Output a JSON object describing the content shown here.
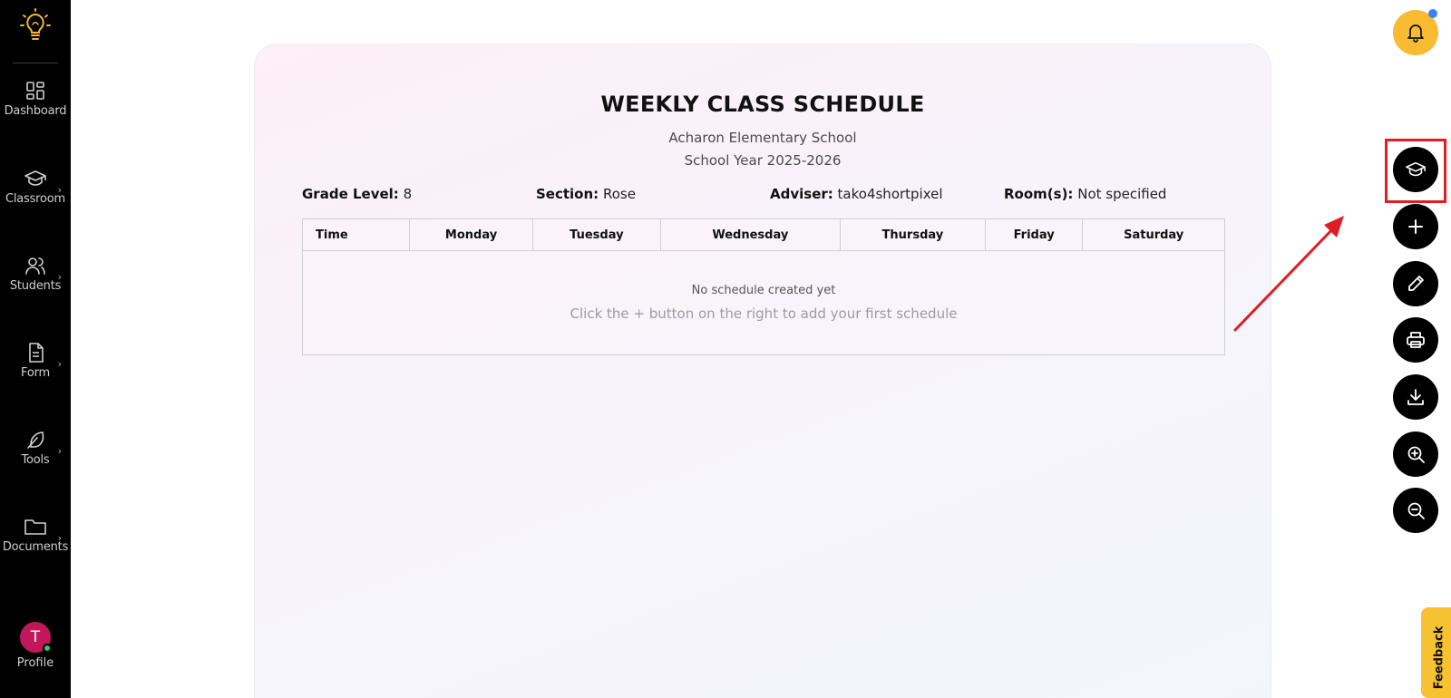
{
  "sidebar": {
    "items": [
      {
        "label": "Dashboard",
        "icon": "dashboard-icon"
      },
      {
        "label": "Classroom",
        "icon": "graduation-cap-icon"
      },
      {
        "label": "Students",
        "icon": "users-icon"
      },
      {
        "label": "Form",
        "icon": "document-icon"
      },
      {
        "label": "Tools",
        "icon": "feather-icon"
      },
      {
        "label": "Documents",
        "icon": "folder-icon"
      }
    ],
    "chevron": "›",
    "profile": {
      "initial": "T",
      "label": "Profile",
      "status_color": "#2ecc71"
    }
  },
  "schedule": {
    "title": "WEEKLY CLASS SCHEDULE",
    "school": "Acharon Elementary School",
    "year": "School Year 2025-2026",
    "info": {
      "grade_label": "Grade Level:",
      "grade_value": "8",
      "section_label": "Section:",
      "section_value": "Rose",
      "adviser_label": "Adviser:",
      "adviser_value": "tako4shortpixel",
      "rooms_label": "Room(s):",
      "rooms_value": "Not specified"
    },
    "columns": [
      "Time",
      "Monday",
      "Tuesday",
      "Wednesday",
      "Thursday",
      "Friday",
      "Saturday"
    ],
    "empty_title": "No schedule created yet",
    "empty_hint": "Click the + button on the right to add your first schedule"
  },
  "floating_buttons": [
    {
      "icon": "bell-icon",
      "color": "#f9bb32"
    },
    {
      "icon": "graduation-cap-icon",
      "highlighted": true
    },
    {
      "icon": "plus-icon"
    },
    {
      "icon": "pencil-icon"
    },
    {
      "icon": "printer-icon"
    },
    {
      "icon": "download-icon"
    },
    {
      "icon": "zoom-in-icon"
    },
    {
      "icon": "zoom-out-icon"
    }
  ],
  "feedback": {
    "label": "Feedback"
  },
  "colors": {
    "accent": "#f9bb32",
    "annotation": "#e31b23",
    "avatar": "#c2185b"
  }
}
